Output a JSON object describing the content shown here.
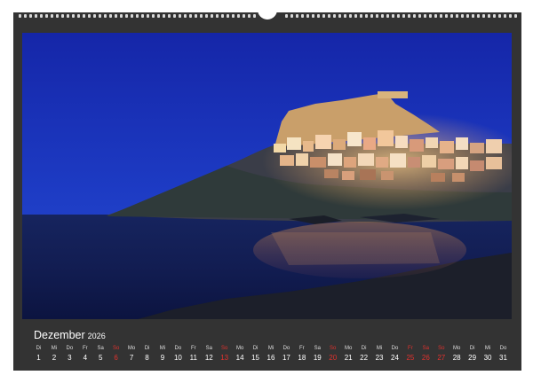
{
  "calendar": {
    "month": "Dezember",
    "year": "2026",
    "days": [
      {
        "wd": "Di",
        "num": "1",
        "red": false
      },
      {
        "wd": "Mi",
        "num": "2",
        "red": false
      },
      {
        "wd": "Do",
        "num": "3",
        "red": false
      },
      {
        "wd": "Fr",
        "num": "4",
        "red": false
      },
      {
        "wd": "Sa",
        "num": "5",
        "red": false
      },
      {
        "wd": "So",
        "num": "6",
        "red": true
      },
      {
        "wd": "Mo",
        "num": "7",
        "red": false
      },
      {
        "wd": "Di",
        "num": "8",
        "red": false
      },
      {
        "wd": "Mi",
        "num": "9",
        "red": false
      },
      {
        "wd": "Do",
        "num": "10",
        "red": false
      },
      {
        "wd": "Fr",
        "num": "11",
        "red": false
      },
      {
        "wd": "Sa",
        "num": "12",
        "red": false
      },
      {
        "wd": "So",
        "num": "13",
        "red": true
      },
      {
        "wd": "Mo",
        "num": "14",
        "red": false
      },
      {
        "wd": "Di",
        "num": "15",
        "red": false
      },
      {
        "wd": "Mi",
        "num": "16",
        "red": false
      },
      {
        "wd": "Do",
        "num": "17",
        "red": false
      },
      {
        "wd": "Fr",
        "num": "18",
        "red": false
      },
      {
        "wd": "Sa",
        "num": "19",
        "red": false
      },
      {
        "wd": "So",
        "num": "20",
        "red": true
      },
      {
        "wd": "Mo",
        "num": "21",
        "red": false
      },
      {
        "wd": "Di",
        "num": "22",
        "red": false
      },
      {
        "wd": "Mi",
        "num": "23",
        "red": false
      },
      {
        "wd": "Do",
        "num": "24",
        "red": false
      },
      {
        "wd": "Fr",
        "num": "25",
        "red": true
      },
      {
        "wd": "Sa",
        "num": "26",
        "red": true
      },
      {
        "wd": "So",
        "num": "27",
        "red": true
      },
      {
        "wd": "Mo",
        "num": "28",
        "red": false
      },
      {
        "wd": "Di",
        "num": "29",
        "red": false
      },
      {
        "wd": "Mi",
        "num": "30",
        "red": false
      },
      {
        "wd": "Do",
        "num": "31",
        "red": false
      }
    ]
  },
  "colors": {
    "frame": "#333333",
    "sky": "#1a2fb0",
    "weekday_text": "#ffffff",
    "holiday_text": "#e0322e"
  }
}
